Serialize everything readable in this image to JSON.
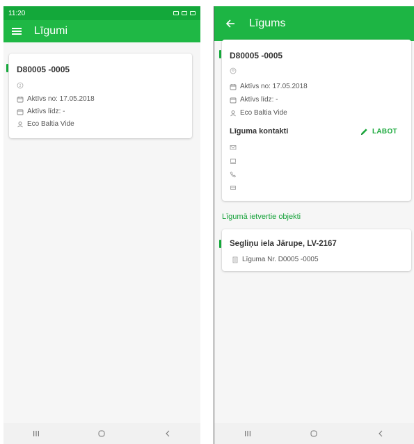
{
  "left": {
    "status": {
      "time": "11:20"
    },
    "appbar": {
      "title": "Līgumi"
    },
    "card": {
      "id": "D80005 -0005",
      "active_from": "Aktīvs no: 17.05.2018",
      "active_to": "Aktīvs līdz: -",
      "company": "Eco Baltia Vide"
    }
  },
  "right": {
    "appbar": {
      "title": "Līgums"
    },
    "card": {
      "id": "D80005 -0005",
      "active_from": "Aktīvs no: 17.05.2018",
      "active_to": "Aktīvs līdz: -",
      "company": "Eco Baltia Vide",
      "contacts_title": "Līguma kontakti",
      "edit_label": "LABOT"
    },
    "objects_heading": "Līgumā ietvertie objekti",
    "object": {
      "address": "Segliņu iela Jārupe, LV-2167",
      "contract_no": "Līguma Nr. D0005 -0005"
    }
  },
  "colors": {
    "primary": "#1fb845",
    "statusbar": "#13a83a",
    "accent": "#14a83a"
  },
  "icons": {
    "menu": "menu-icon",
    "back": "arrow-back-icon",
    "calendar": "calendar-icon",
    "person": "person-icon",
    "email": "email-icon",
    "phone": "phone-icon",
    "edit": "pencil-icon",
    "document": "document-icon"
  }
}
